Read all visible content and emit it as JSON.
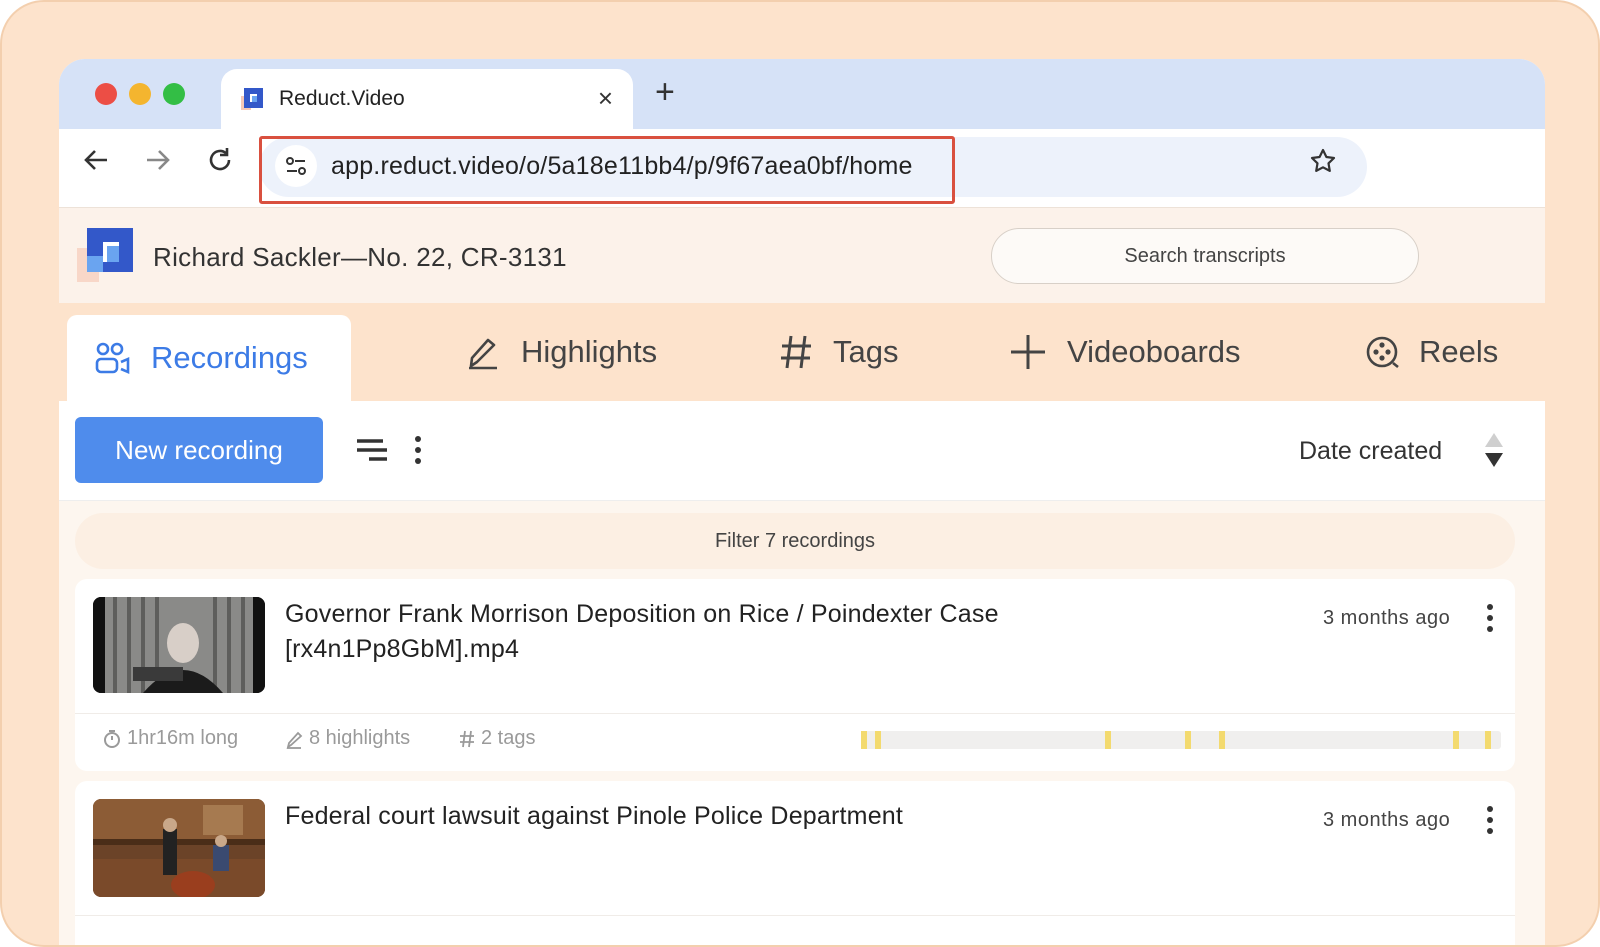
{
  "browser": {
    "tab_title": "Reduct.Video",
    "tab_close": "×",
    "new_tab": "+",
    "url": "app.reduct.video/o/5a18e11bb4/p/9f67aea0bf/home"
  },
  "header": {
    "project_title": "Richard Sackler—No. 22, CR-3131",
    "search_placeholder": "Search transcripts"
  },
  "nav": {
    "tabs": [
      {
        "label": "Recordings",
        "icon": "people-icon",
        "active": true
      },
      {
        "label": "Highlights",
        "icon": "highlighter-icon"
      },
      {
        "label": "Tags",
        "icon": "hash-icon"
      },
      {
        "label": "Videoboards",
        "icon": "plus-icon"
      },
      {
        "label": "Reels",
        "icon": "reel-icon"
      }
    ]
  },
  "toolbar": {
    "new_recording_label": "New recording",
    "sort_label": "Date created"
  },
  "list": {
    "filter_label": "Filter 7 recordings",
    "recordings": [
      {
        "title": "Governor Frank Morrison Deposition on Rice / Poindexter Case [rx4n1Pp8GbM].mp4",
        "date": "3 months ago",
        "duration": "1hr16m long",
        "highlights": "8 highlights",
        "tags": "2 tags"
      },
      {
        "title": "Federal court lawsuit against Pinole Police Department",
        "date": "3 months ago"
      }
    ]
  },
  "colors": {
    "accent": "#3c7be6",
    "button": "#4f8cec",
    "frame": "#fde3cc",
    "highlight_tick": "#f3da6f",
    "url_outline": "#d9503f"
  }
}
